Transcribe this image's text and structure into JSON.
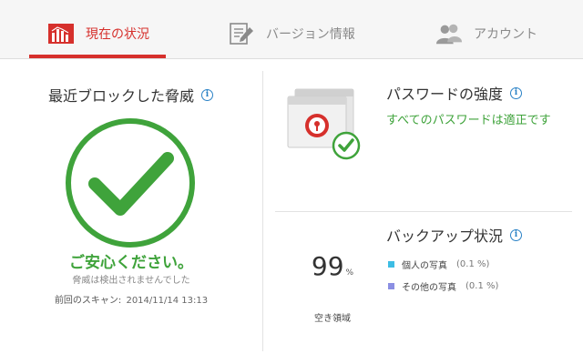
{
  "tabs": [
    {
      "label": "現在の状況",
      "icon": "bar-chart-icon",
      "active": true
    },
    {
      "label": "バージョン情報",
      "icon": "document-edit-icon",
      "active": false
    },
    {
      "label": "アカウント",
      "icon": "users-icon",
      "active": false
    }
  ],
  "threats": {
    "title": "最近ブロックした脅威",
    "info_icon": "i",
    "status_icon": "checkmark-icon",
    "message": "ご安心ください。",
    "sub_message": "脅威は検出されませんでした",
    "last_scan_label": "前回のスキャン:",
    "last_scan_value": "2014/11/14 13:13"
  },
  "password": {
    "title": "パスワードの強度",
    "info_icon": "i",
    "illustration": "password-manager-icon",
    "status": "すべてのパスワードは適正です"
  },
  "backup": {
    "title": "バックアップ状況",
    "info_icon": "i",
    "free_space_value": "99",
    "free_space_unit": "%",
    "free_space_label": "空き領域",
    "items": [
      {
        "label": "個人の写真",
        "percent": "(0.1 %)",
        "color": "#3dbde4"
      },
      {
        "label": "その他の写真",
        "percent": "(0.1 %)",
        "color": "#8b8fe3"
      }
    ]
  },
  "colors": {
    "accent": "#d6302c",
    "success": "#3fa33b",
    "info": "#2a82c6"
  }
}
